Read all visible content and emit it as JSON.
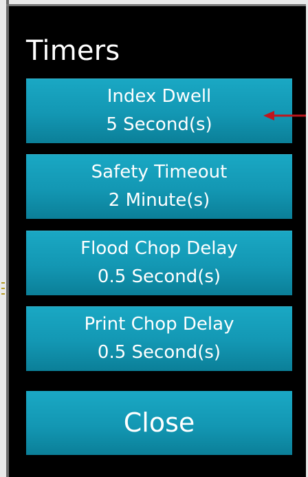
{
  "dialog": {
    "title": "Timers",
    "timers": [
      {
        "label": "Index Dwell",
        "value": "5 Second(s)"
      },
      {
        "label": "Safety Timeout",
        "value": "2 Minute(s)"
      },
      {
        "label": "Flood Chop Delay",
        "value": "0.5 Second(s)"
      },
      {
        "label": "Print Chop Delay",
        "value": "0.5 Second(s)"
      }
    ],
    "close_label": "Close"
  },
  "annotation": {
    "icon": "arrow-left-icon",
    "color": "#c0161c"
  },
  "theme": {
    "button_color": "#1397b3",
    "background": "#000000",
    "text": "#ffffff"
  }
}
